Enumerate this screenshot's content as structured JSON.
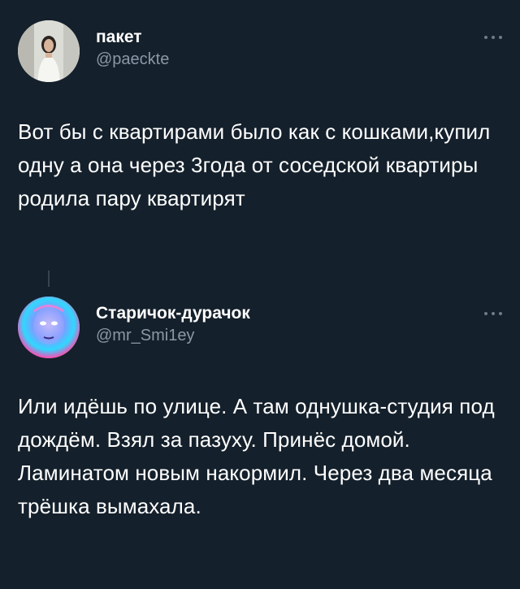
{
  "theme": {
    "background": "#14202b",
    "text": "#ffffff",
    "secondary_text": "#8b98a5",
    "thread_line": "#38444d"
  },
  "tweets": [
    {
      "display_name": "пакет",
      "handle": "@paeckte",
      "avatar_icon": "person-photo-avatar",
      "more_icon": "ellipsis-icon",
      "text": "Вот бы с квартирами было как с кошками,купил одну а она через 3года от соседской квартиры родила пару квартирят"
    },
    {
      "display_name": "Старичок-дурачок",
      "handle": "@mr_Smi1ey",
      "avatar_icon": "colorful-face-avatar",
      "more_icon": "ellipsis-icon",
      "text": "Или идёшь по улице. А там однушка-студия под дождём. Взял за пазуху. Принёс домой. Ламинатом новым накормил. Через два месяца трёшка вымахала."
    }
  ]
}
